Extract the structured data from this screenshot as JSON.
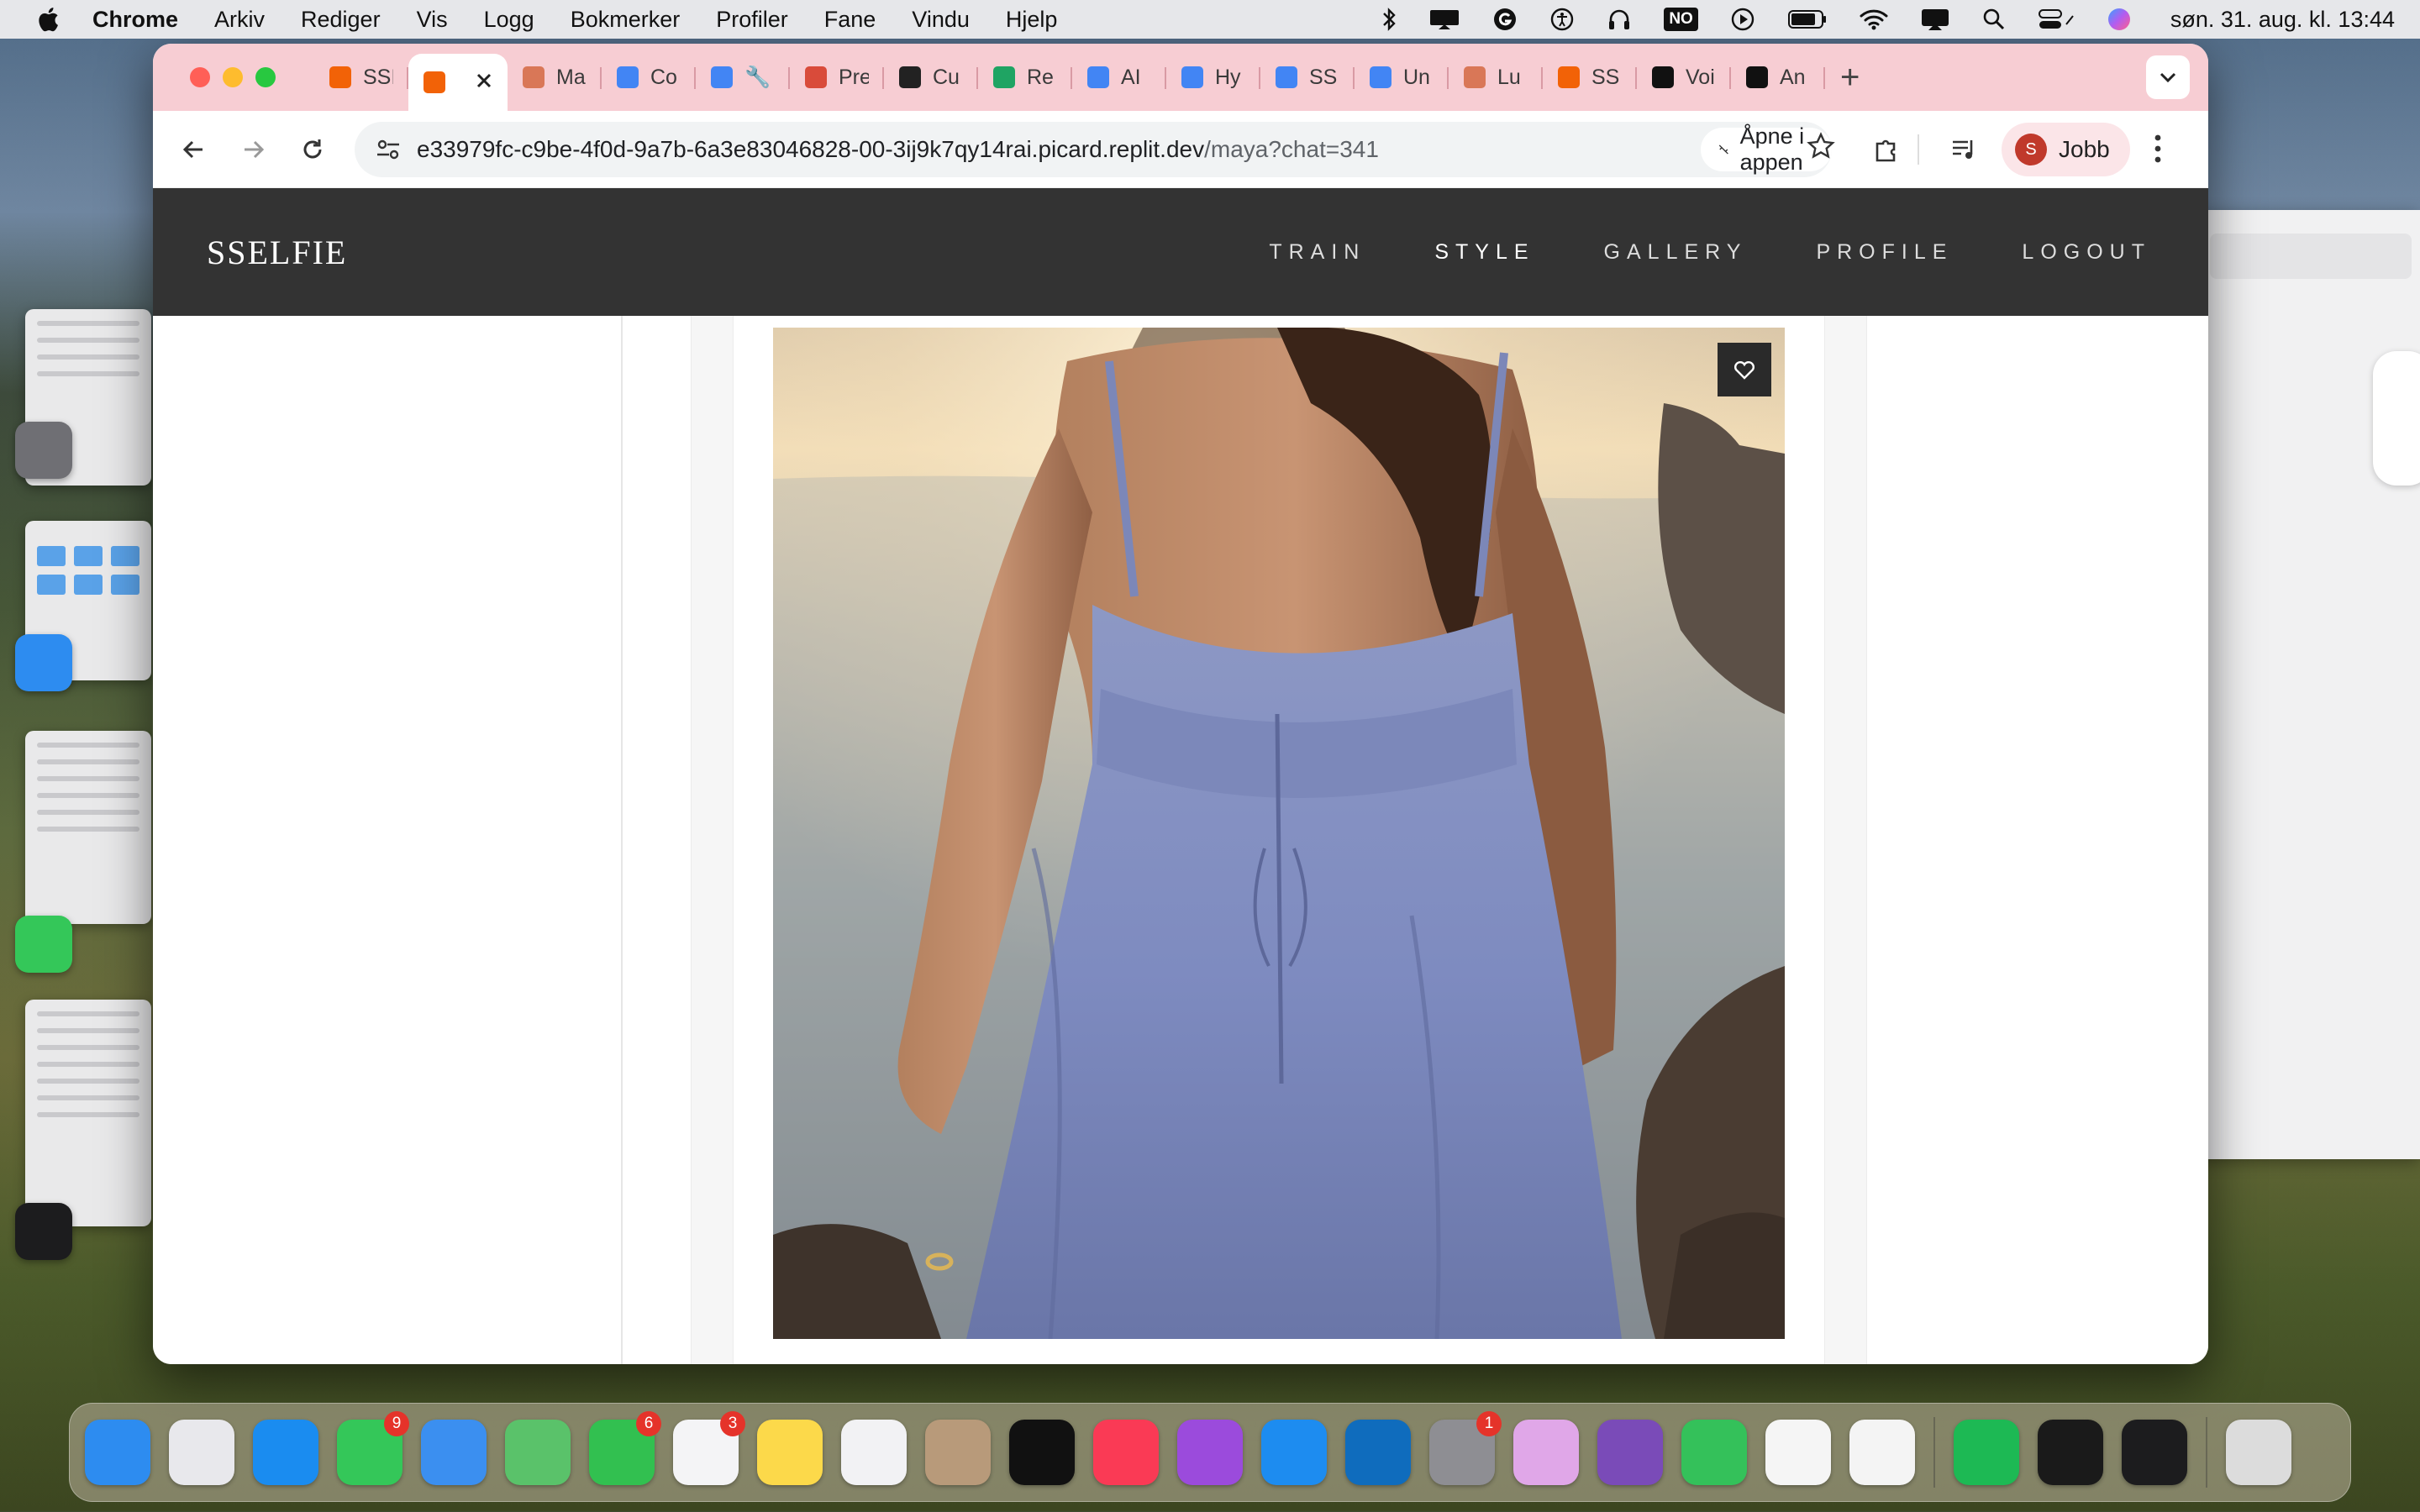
{
  "menubar": {
    "app_name": "Chrome",
    "items": [
      "Arkiv",
      "Rediger",
      "Vis",
      "Logg",
      "Bokmerker",
      "Profiler",
      "Fane",
      "Vindu",
      "Hjelp"
    ],
    "input_badge": "NO",
    "clock": "søn. 31. aug. kl. 13:44"
  },
  "browser": {
    "tabs": [
      {
        "label": "SSI",
        "icon": "replit-icon",
        "color": "#f26207"
      },
      {
        "label": "",
        "icon": "replit-icon",
        "color": "#f26207",
        "active": true
      },
      {
        "label": "Ma",
        "icon": "claude-icon",
        "color": "#d97757"
      },
      {
        "label": "Co",
        "icon": "docs-icon",
        "color": "#4285f4"
      },
      {
        "label": "🔧",
        "icon": "docs-icon",
        "color": "#4285f4"
      },
      {
        "label": "Pre",
        "icon": "slides-icon",
        "color": "#d94b3a"
      },
      {
        "label": "Cu",
        "icon": "chatgpt-icon",
        "color": "#222222"
      },
      {
        "label": "Re",
        "icon": "drive-icon",
        "color": "#1fa463"
      },
      {
        "label": "AI",
        "icon": "docs-icon",
        "color": "#4285f4"
      },
      {
        "label": "Hy",
        "icon": "docs-icon",
        "color": "#4285f4"
      },
      {
        "label": "SS",
        "icon": "docs-icon",
        "color": "#4285f4"
      },
      {
        "label": "Un",
        "icon": "docs-icon",
        "color": "#4285f4"
      },
      {
        "label": "Lu",
        "icon": "claude-icon",
        "color": "#d97757"
      },
      {
        "label": "SS",
        "icon": "replit-icon",
        "color": "#f26207"
      },
      {
        "label": "Voi",
        "icon": "voice-icon",
        "color": "#111111"
      },
      {
        "label": "An",
        "icon": "anthropic-icon",
        "color": "#111111"
      }
    ],
    "url_host": "e33979fc-c9be-4f0d-9a7b-6a3e83046828-00-3ij9k7qy14rai.picard.replit.dev",
    "url_path": "/maya?chat=341",
    "open_in_app": "Åpne i appen",
    "profile_initial": "S",
    "profile_name": "Jobb"
  },
  "site": {
    "logo": "SSELFIE",
    "nav": [
      "TRAIN",
      "STYLE",
      "GALLERY",
      "PROFILE",
      "LOGOUT"
    ],
    "active_nav": "STYLE"
  },
  "photo": {
    "subject": "woman in lavender backless dress by the sea at sunset",
    "favorite_icon": "heart-icon"
  },
  "dock": {
    "apps": [
      {
        "name": "Finder",
        "color": "#2d8cf0"
      },
      {
        "name": "Launchpad",
        "color": "#e8e8ec"
      },
      {
        "name": "Safari",
        "color": "#1a8cf0"
      },
      {
        "name": "Messages",
        "color": "#34c759",
        "badge": "9"
      },
      {
        "name": "Mail",
        "color": "#3b8ff0"
      },
      {
        "name": "Maps",
        "color": "#5ac26a"
      },
      {
        "name": "FaceTime",
        "color": "#32c050",
        "badge": "6"
      },
      {
        "name": "Reminders",
        "color": "#f4f4f6",
        "badge": "3"
      },
      {
        "name": "Notes",
        "color": "#fcd94a"
      },
      {
        "name": "Freeform",
        "color": "#f2f2f4"
      },
      {
        "name": "Contacts",
        "color": "#b89a7a"
      },
      {
        "name": "TV",
        "color": "#111111"
      },
      {
        "name": "Music",
        "color": "#fa3a55"
      },
      {
        "name": "Podcasts",
        "color": "#9b4bdc"
      },
      {
        "name": "App Store",
        "color": "#1d8cf0"
      },
      {
        "name": "Outlook",
        "color": "#0f6cbd"
      },
      {
        "name": "System Settings",
        "color": "#8e8e93",
        "badge": "1"
      },
      {
        "name": "Keynote",
        "color": "#e0a7e8"
      },
      {
        "name": "GitHub Desktop",
        "color": "#7a4bb8"
      },
      {
        "name": "Numbers",
        "color": "#34c15a"
      },
      {
        "name": "Perplexity",
        "color": "#f5f5f5"
      },
      {
        "name": "Chrome",
        "color": "#f4f4f4"
      },
      {
        "name": "Spotify",
        "color": "#1db954"
      },
      {
        "name": "Cursor",
        "color": "#1a1a1a"
      },
      {
        "name": "Voice Memos",
        "color": "#1c1c1e"
      },
      {
        "name": "Trash",
        "color": "#dcdcdc"
      }
    ]
  }
}
